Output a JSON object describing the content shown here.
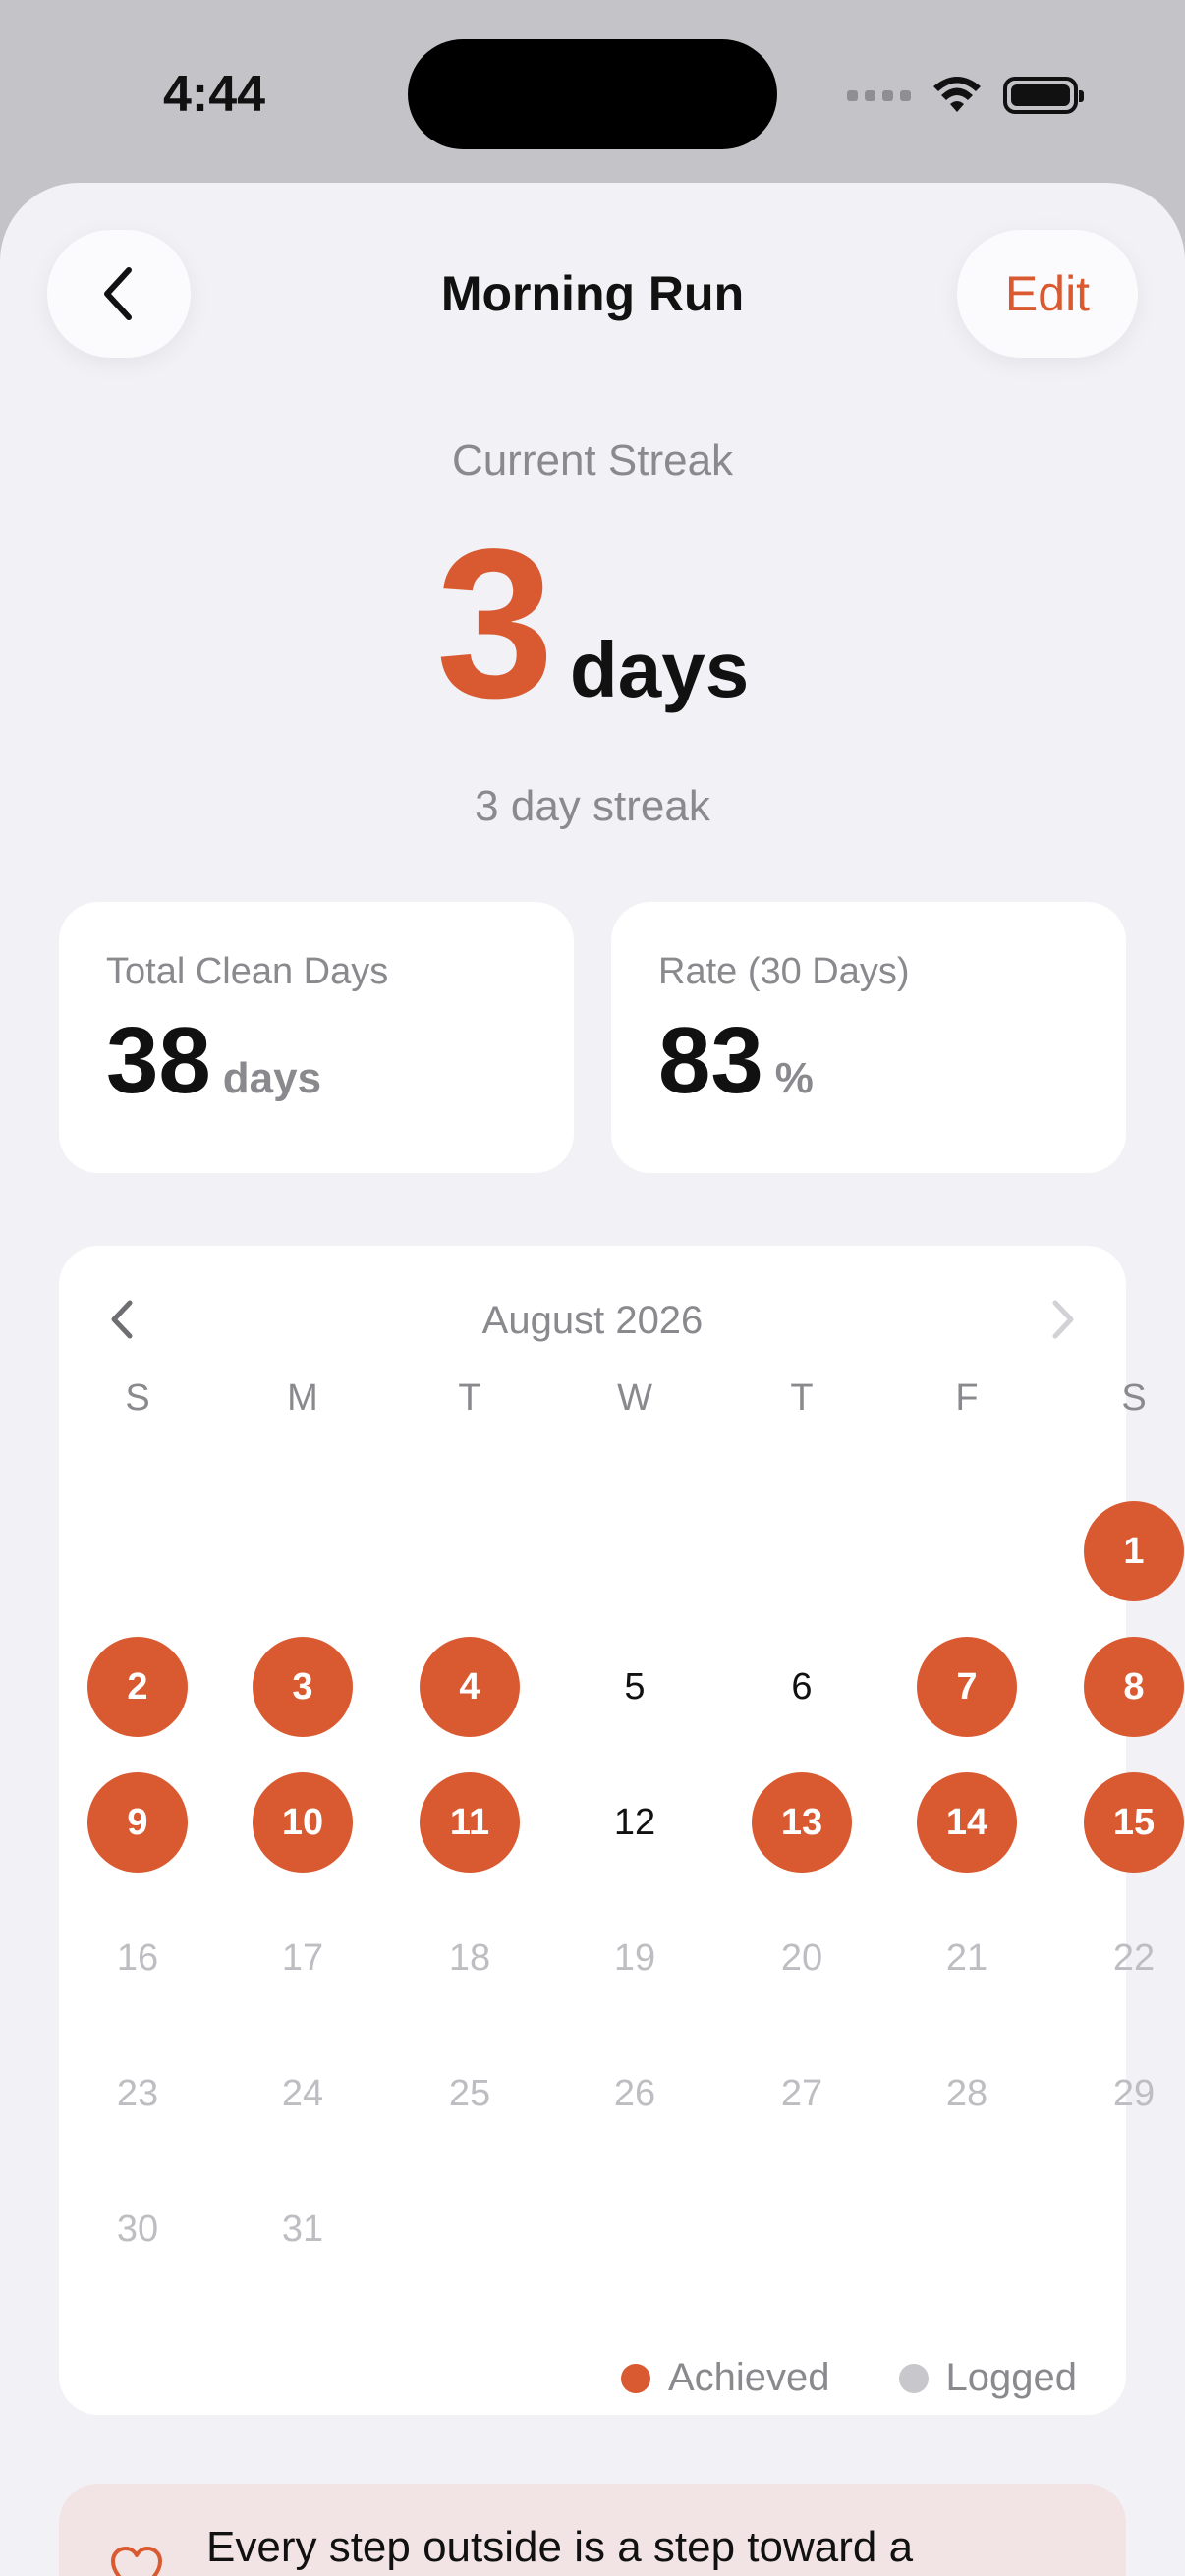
{
  "status_bar": {
    "time": "4:44"
  },
  "header": {
    "title": "Morning Run",
    "edit_label": "Edit"
  },
  "streak": {
    "label": "Current Streak",
    "value": "3",
    "unit": "days",
    "subtitle": "3 day streak"
  },
  "stats": [
    {
      "label": "Total Clean Days",
      "value": "38",
      "unit": "days"
    },
    {
      "label": "Rate (30 Days)",
      "value": "83",
      "unit": "%"
    }
  ],
  "calendar": {
    "month": "August 2026",
    "weekdays": [
      "S",
      "M",
      "T",
      "W",
      "T",
      "F",
      "S"
    ],
    "days": [
      {
        "n": "1",
        "s": "achieved"
      },
      {
        "n": "2",
        "s": "achieved"
      },
      {
        "n": "3",
        "s": "achieved"
      },
      {
        "n": "4",
        "s": "achieved"
      },
      {
        "n": "5",
        "s": "none"
      },
      {
        "n": "6",
        "s": "none"
      },
      {
        "n": "7",
        "s": "achieved"
      },
      {
        "n": "8",
        "s": "achieved"
      },
      {
        "n": "9",
        "s": "achieved"
      },
      {
        "n": "10",
        "s": "achieved"
      },
      {
        "n": "11",
        "s": "achieved"
      },
      {
        "n": "12",
        "s": "none"
      },
      {
        "n": "13",
        "s": "achieved"
      },
      {
        "n": "14",
        "s": "achieved"
      },
      {
        "n": "15",
        "s": "achieved"
      },
      {
        "n": "16",
        "s": "future"
      },
      {
        "n": "17",
        "s": "future"
      },
      {
        "n": "18",
        "s": "future"
      },
      {
        "n": "19",
        "s": "future"
      },
      {
        "n": "20",
        "s": "future"
      },
      {
        "n": "21",
        "s": "future"
      },
      {
        "n": "22",
        "s": "future"
      },
      {
        "n": "23",
        "s": "future"
      },
      {
        "n": "24",
        "s": "future"
      },
      {
        "n": "25",
        "s": "future"
      },
      {
        "n": "26",
        "s": "future"
      },
      {
        "n": "27",
        "s": "future"
      },
      {
        "n": "28",
        "s": "future"
      },
      {
        "n": "29",
        "s": "future"
      },
      {
        "n": "30",
        "s": "future"
      },
      {
        "n": "31",
        "s": "future"
      }
    ],
    "legend": [
      {
        "label": "Achieved",
        "color": "#d95a31"
      },
      {
        "label": "Logged",
        "color": "#c7c7cc"
      }
    ]
  },
  "note": {
    "text": "Every step outside is a step toward a"
  },
  "colors": {
    "accent": "#d95a31",
    "background": "#f2f1f6"
  }
}
